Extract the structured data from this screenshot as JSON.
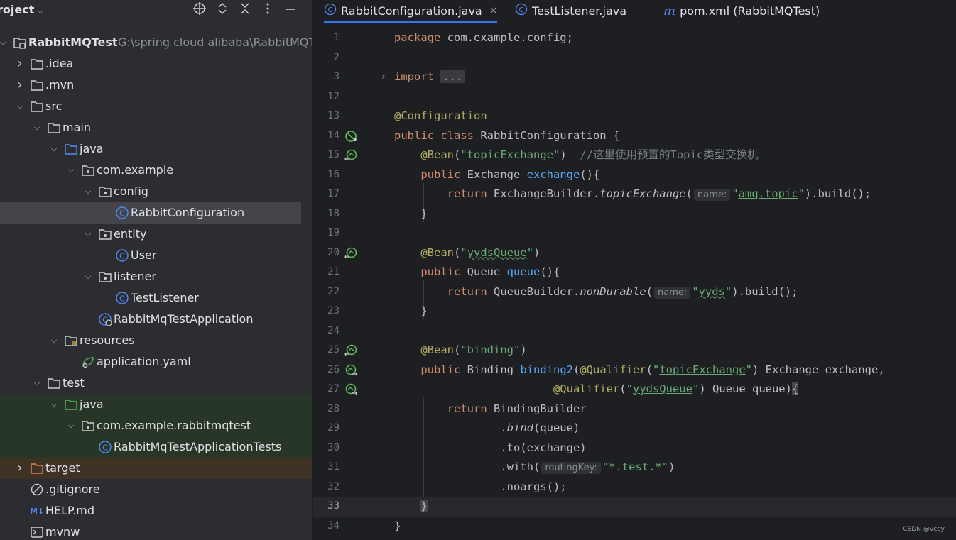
{
  "project_panel": {
    "title": "roject",
    "tools": [
      "crosshair-icon",
      "expand-icon",
      "collapse-icon",
      "more-icon",
      "minimize-icon"
    ],
    "tree": [
      {
        "label": "RabbitMQTest",
        "sub": "G:\\spring cloud alibaba\\RabbitMQT",
        "icon": "module-icon",
        "arrow": "down",
        "bold": true
      },
      {
        "label": ".idea",
        "icon": "folder-icon",
        "arrow": "right"
      },
      {
        "label": ".mvn",
        "icon": "folder-icon",
        "arrow": "right"
      },
      {
        "label": "src",
        "icon": "folder-icon",
        "arrow": "down"
      },
      {
        "label": "main",
        "icon": "folder-icon",
        "arrow": "down"
      },
      {
        "label": "java",
        "icon": "source-folder-icon",
        "arrow": "down"
      },
      {
        "label": "com.example",
        "icon": "package-icon",
        "arrow": "down"
      },
      {
        "label": "config",
        "icon": "package-icon",
        "arrow": "down"
      },
      {
        "label": "RabbitConfiguration",
        "icon": "class-icon",
        "arrow": "",
        "selected": true
      },
      {
        "label": "entity",
        "icon": "package-icon",
        "arrow": "down"
      },
      {
        "label": "User",
        "icon": "class-icon",
        "arrow": ""
      },
      {
        "label": "listener",
        "icon": "package-icon",
        "arrow": "down"
      },
      {
        "label": "TestListener",
        "icon": "class-icon",
        "arrow": ""
      },
      {
        "label": "RabbitMqTestApplication",
        "icon": "spring-class-icon",
        "arrow": ""
      },
      {
        "label": "resources",
        "icon": "resources-folder-icon",
        "arrow": "down"
      },
      {
        "label": "application.yaml",
        "icon": "spring-yaml-icon",
        "arrow": ""
      },
      {
        "label": "test",
        "icon": "folder-icon",
        "arrow": "down"
      },
      {
        "label": "java",
        "icon": "test-folder-icon",
        "arrow": "down",
        "bg": "green"
      },
      {
        "label": "com.example.rabbitmqtest",
        "icon": "package-icon",
        "arrow": "down",
        "bg": "green"
      },
      {
        "label": "RabbitMqTestApplicationTests",
        "icon": "class-icon",
        "arrow": "",
        "bg": "green"
      },
      {
        "label": "target",
        "icon": "excluded-folder-icon",
        "arrow": "right",
        "bg": "brown"
      },
      {
        "label": ".gitignore",
        "icon": "ignore-icon",
        "arrow": ""
      },
      {
        "label": "HELP.md",
        "icon": "markdown-icon",
        "arrow": ""
      },
      {
        "label": "mvnw",
        "icon": "terminal-icon",
        "arrow": ""
      }
    ]
  },
  "tabs": [
    {
      "label": "RabbitConfiguration.java",
      "icon": "class-icon",
      "active": true,
      "close": "×"
    },
    {
      "label": "TestListener.java",
      "icon": "class-icon",
      "active": false
    },
    {
      "label": "pom.xml (RabbitMQTest)",
      "icon": "maven-icon",
      "active": false
    }
  ],
  "line_numbers": [
    "1",
    "2",
    "3",
    "12",
    "13",
    "14",
    "15",
    "16",
    "17",
    "18",
    "19",
    "20",
    "21",
    "22",
    "23",
    "24",
    "25",
    "26",
    "27",
    "28",
    "29",
    "30",
    "31",
    "32",
    "33",
    "34"
  ],
  "code_text": {
    "l1_kw": "package",
    "l1_rest": " com.example.config;",
    "l3_kw": "import",
    "l3_fold": "...",
    "l13_ann": "@Configuration",
    "l14_kw": "public class",
    "l14_rest": " RabbitConfiguration {",
    "l15_ann": "@Bean",
    "l15_p1": "(",
    "l15_str": "\"topicExchange\"",
    "l15_p2": ")  ",
    "l15_cmt": "//这里使用预置的Topic类型交换机",
    "l16_kw": "public",
    "l16_type": " Exchange ",
    "l16_fn": "exchange",
    "l16_rest": "(){",
    "l17_kw": "return",
    "l17_a": " ExchangeBuilder.",
    "l17_it": "topicExchange",
    "l17_p": "(",
    "l17_hint": "name:",
    "l17_q1": "\"",
    "l17_str": "amq.topic",
    "l17_q2": "\"",
    "l17_end": ").build();",
    "l18": "}",
    "l20_ann": "@Bean",
    "l20_p1": "(",
    "l20_q1": "\"",
    "l20_str": "yydsQueue",
    "l20_q2": "\"",
    "l20_p2": ")",
    "l21_kw": "public",
    "l21_type": " Queue ",
    "l21_fn": "queue",
    "l21_rest": "(){",
    "l22_kw": "return",
    "l22_a": " QueueBuilder.",
    "l22_it": "nonDurable",
    "l22_p": "(",
    "l22_hint": "name:",
    "l22_q1": "\"",
    "l22_str": "yyds",
    "l22_q2": "\"",
    "l22_end": ").build();",
    "l23": "}",
    "l25_ann": "@Bean",
    "l25_p1": "(",
    "l25_str": "\"binding\"",
    "l25_p2": ")",
    "l26_kw": "public",
    "l26_type": " Binding ",
    "l26_fn": "binding2",
    "l26_p": "(",
    "l26_ann": "@Qualifier",
    "l26_p2": "(",
    "l26_q1": "\"",
    "l26_str": "topicExchange",
    "l26_q2": "\"",
    "l26_end": ") Exchange exchange,",
    "l27_ann": "@Qualifier",
    "l27_p": "(",
    "l27_q1": "\"",
    "l27_str": "yydsQueue",
    "l27_q2": "\"",
    "l27_end": ") Queue queue)",
    "l27_brace": "{",
    "l28_kw": "return",
    "l28_rest": " BindingBuilder",
    "l29_a": ".",
    "l29_it": "bind",
    "l29_rest": "(queue)",
    "l30": ".to(exchange)",
    "l31_a": ".with(",
    "l31_hint": "routingKey:",
    "l31_str": "\"*.test.*\"",
    "l31_end": ")",
    "l32": ".noargs();",
    "l33": "}",
    "l34": "}"
  },
  "watermark": "CSDN @vcoy"
}
